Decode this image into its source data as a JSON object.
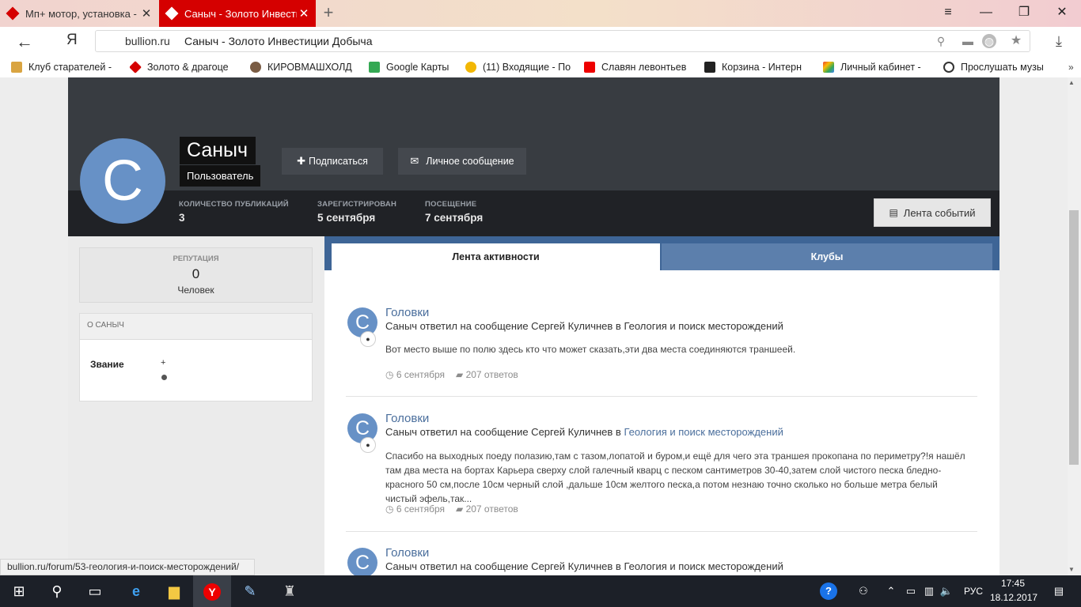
{
  "browser": {
    "tabs": [
      {
        "label": "Мп+ мотор, установка - стр",
        "active": false
      },
      {
        "label": "Саныч - Золото Инвести",
        "active": true
      }
    ],
    "new_tab": "+",
    "window_controls": {
      "menu": "≡",
      "minimize": "—",
      "restore": "❐",
      "close": "✕"
    },
    "address": {
      "domain": "bullion.ru",
      "title": "Саныч - Золото Инвестиции Добыча"
    },
    "bookmarks": [
      "Клуб старателей -",
      "Золото & драгоце",
      "КИРОВМАШХОЛД",
      "Google Карты",
      "(11) Входящие - По",
      "Славян левонтьев",
      "Корзина - Интерн",
      "Личный кабинет -",
      "Прослушать музы"
    ],
    "more": "»",
    "status_url": "bullion.ru/forum/53-геология-и-поиск-месторождений/"
  },
  "profile": {
    "avatar_letter": "С",
    "name": "Саныч",
    "role": "Пользователь",
    "follow": "Подписаться",
    "message": "Личное сообщение",
    "stats": [
      {
        "label": "КОЛИЧЕСТВО ПУБЛИКАЦИЙ",
        "value": "3"
      },
      {
        "label": "ЗАРЕГИСТРИРОВАН",
        "value": "5 сентября"
      },
      {
        "label": "ПОСЕЩЕНИЕ",
        "value": "7 сентября"
      }
    ],
    "feed_button": "Лента событий"
  },
  "sidebar": {
    "reputation_label": "РЕПУТАЦИЯ",
    "reputation_value": "0",
    "reputation_sub": "Человек",
    "about_title": "О САНЫЧ",
    "rank_label": "Звание",
    "rank_value": "+"
  },
  "tabs": {
    "activity": "Лента активности",
    "clubs": "Клубы"
  },
  "posts": [
    {
      "letter": "С",
      "title": "Головки",
      "desc_prefix": "Саныч ответил на сообщение Сергей Куличнев в ",
      "desc_link": "Геология и поиск месторождений",
      "text": "Вот место выше по полю здесь кто что может сказать,эти два места соединяются траншеей.",
      "date": "6 сентября",
      "replies": "207 ответов"
    },
    {
      "letter": "С",
      "title": "Головки",
      "desc_prefix": "Саныч ответил на сообщение Сергей Куличнев в ",
      "desc_link": "Геология и поиск месторождений",
      "text": "Спасибо на выходных поеду полазию,там с тазом,лопатой и буром,и ещё для чего эта траншея прокопана по периметру?!я нашёл там два места на бортах Карьера сверху слой галечный кварц с песком сантиметров 30-40,затем слой чистого песка бледно-красного 50 см,после 10см черный слой ,дальше 10см желтого песка,а потом незнаю точно сколько но больше метра белый чистый эфель,так...",
      "date": "6 сентября",
      "replies": "207 ответов"
    },
    {
      "letter": "С",
      "title": "Головки",
      "desc_prefix": "Саныч ответил на сообщение Сергей Куличнев в ",
      "desc_link": "Геология и поиск месторождений"
    }
  ],
  "taskbar": {
    "lang": "РУС",
    "time": "17:45",
    "date": "18.12.2017"
  },
  "colors": {
    "brand_red": "#d50000",
    "accent_blue": "#3e6596",
    "avatar": "#6791c6"
  }
}
